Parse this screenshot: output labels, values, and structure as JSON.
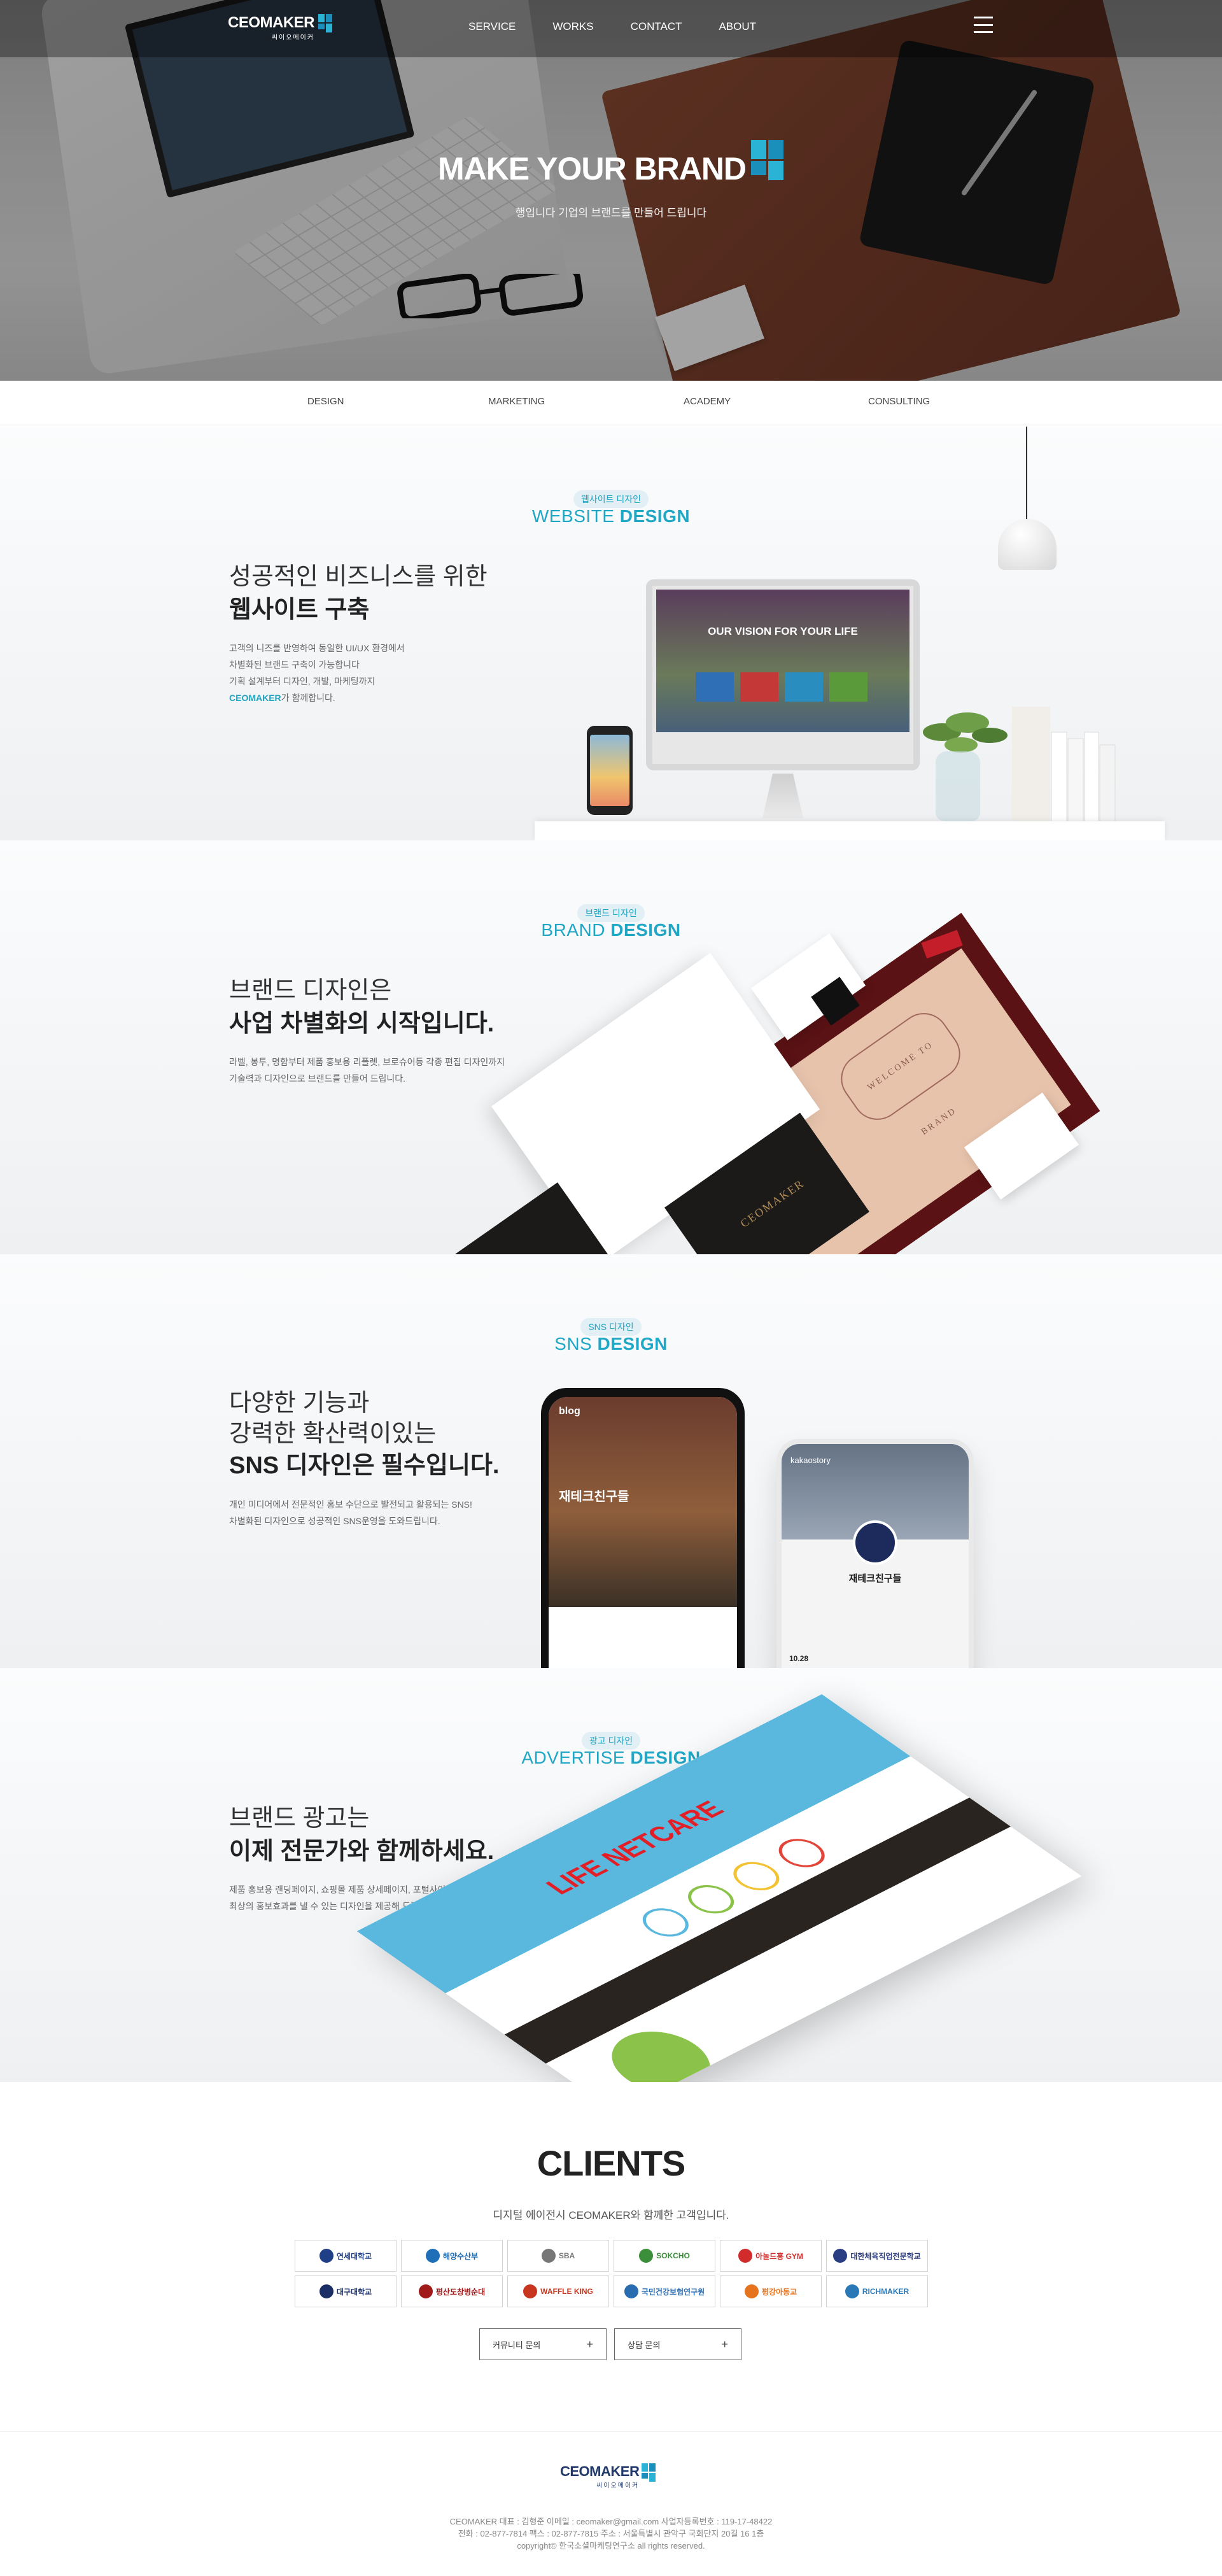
{
  "header": {
    "logo_text": "CEOMAKER",
    "logo_sub": "씨이오메이커",
    "nav": [
      "SERVICE",
      "WORKS",
      "CONTACT",
      "ABOUT"
    ],
    "brand_colors": {
      "accent": "#20a7c5",
      "navy": "#223a6b"
    }
  },
  "hero": {
    "title": "MAKE YOUR BRAND",
    "subtitle": "행입니다 기업의 브랜드를 만들어 드립니다"
  },
  "categories": [
    "DESIGN",
    "MARKETING",
    "ACADEMY",
    "CONSULTING"
  ],
  "sections": {
    "website": {
      "kicker": "웹사이트 디자인",
      "title_light": "WEBSITE",
      "title_bold": "DESIGN",
      "heading_line1": "성공적인 비즈니스를 위한",
      "heading_line2": "웹사이트 구축",
      "body_line1": "고객의 니즈를 반영하여 동일한 UI/UX 환경에서",
      "body_line2": "차별화된 브랜드 구축이 가능합니다",
      "body_line3": "기획 설계부터 디자인, 개발, 마케팅까지",
      "body_accent": "CEOMAKER",
      "body_line4_rest": "가 함께합니다.",
      "monitor_text": "OUR VISION FOR YOUR LIFE"
    },
    "brand": {
      "kicker": "브랜드 디자인",
      "title_light": "BRAND",
      "title_bold": "DESIGN",
      "heading_line1": "브랜드 디자인은",
      "heading_line2": "사업 차별화의 시작입니다.",
      "body_line1": "라벨, 봉투, 명함부터 제품 홍보용 리플렛, 브로슈어등 각종 편집 디자인까지",
      "body_line2": "기술력과 디자인으로 브랜드를 만들어 드립니다.",
      "stamp_text": "WELCOME TO BRAND",
      "gold_text": "CEOMAKER"
    },
    "sns": {
      "kicker": "SNS 디자인",
      "title_light": "SNS",
      "title_bold": "DESIGN",
      "heading_line1": "다양한 기능과",
      "heading_line2": "강력한 확산력이있는",
      "heading_line3": "SNS 디자인은 필수입니다.",
      "body_line1": "개인 미디어에서 전문적인 홍보 수단으로 발전되고 활용되는 SNS!",
      "body_line2": "차별화된 디자인으로 성공적인 SNS운영을 도와드립니다.",
      "phone1_label": "blog",
      "phone1_title": "재테크친구들",
      "phone2_label": "kakaostory",
      "phone2_title": "재테크친구들",
      "phone2_date": "10.28"
    },
    "advertise": {
      "kicker": "광고 디자인",
      "title_light": "ADVERTISE",
      "title_bold": "DESIGN",
      "heading_line1": "브랜드 광고는",
      "heading_line2": "이제 전문가와 함께하세요.",
      "body_line1": "제품 홍보용 랜딩페이지, 쇼핑몰 제품 상세페이지, 포털사이트 배너광고 등",
      "body_line2": "최상의 홍보효과를 낼 수 있는 디자인을 제공해 드립니다.",
      "board_text": "LIFE NETCARE"
    }
  },
  "clients": {
    "title": "CLIENTS",
    "subtitle": "디지털 에이전시 CEOMAKER와 함께한 고객입니다.",
    "logos": [
      {
        "name": "연세대학교",
        "color": "#1f3f86"
      },
      {
        "name": "해양수산부",
        "color": "#1e6fb8"
      },
      {
        "name": "SBA",
        "color": "#777777"
      },
      {
        "name": "SOKCHO",
        "color": "#3b8e3a"
      },
      {
        "name": "아놀드홍 GYM",
        "color": "#d12b2b"
      },
      {
        "name": "대한체육직업전문학교",
        "color": "#2b3e84"
      },
      {
        "name": "대구대학교",
        "color": "#1b2f66"
      },
      {
        "name": "평산도창병순대",
        "color": "#a01a1a"
      },
      {
        "name": "WAFFLE KING",
        "color": "#c9361f"
      },
      {
        "name": "국민건강보험연구원",
        "color": "#2a6cb0"
      },
      {
        "name": "평강아동교",
        "color": "#e6731e"
      },
      {
        "name": "RICHMAKER",
        "color": "#2b78b6"
      }
    ],
    "cta": [
      {
        "label": "커뮤니티 문의",
        "icon": "plus-icon"
      },
      {
        "label": "상담 문의",
        "icon": "plus-icon"
      }
    ]
  },
  "footer": {
    "logo_text": "CEOMAKER",
    "logo_sub": "씨이오메이커",
    "line1": "CEOMAKER 대표 : 김형준 이메일 : ceomaker@gmail.com 사업자등록번호 : 119-17-48422",
    "line2": "전화 : 02-877-7814 팩스 : 02-877-7815 주소 : 서울특별시 관악구 국회단지 20길 16 1층",
    "line3": "copyright© 한국소셜마케팅연구소 all rights reserved."
  }
}
